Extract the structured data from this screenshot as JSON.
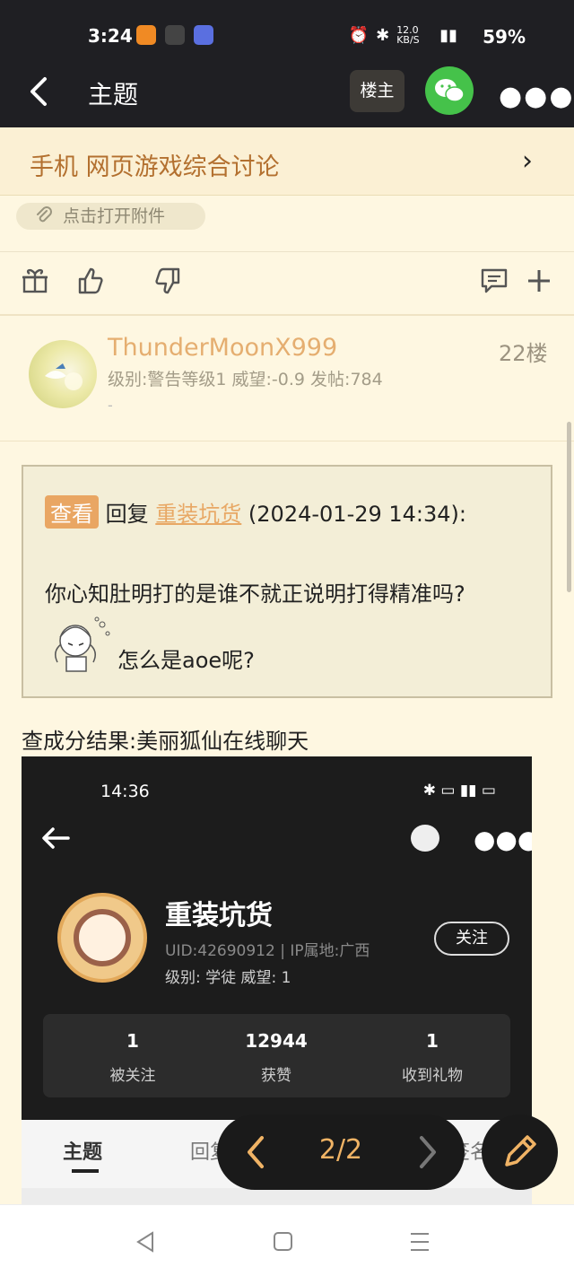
{
  "status_bar": {
    "time": "3:24",
    "network": "12.0 KB/S",
    "battery": "59%"
  },
  "nav": {
    "title": "主题",
    "op_button": "楼主"
  },
  "forum": {
    "name": "手机 网页游戏综合讨论"
  },
  "attachment": {
    "label": "点击打开附件"
  },
  "post": {
    "username": "ThunderMoonX999",
    "info": "级别:警告等级1 威望:-0.9 发帖:784",
    "signature": "-",
    "floor": "22楼"
  },
  "quote": {
    "tag": "查看",
    "reply_word": "回复",
    "reply_user": "重装坑货",
    "reply_time": "(2024-01-29 14:34):",
    "line1": "你心知肚明打的是谁不就正说明打得精准吗?",
    "line2": "怎么是aoe呢?"
  },
  "result_text": "查成分结果:美丽狐仙在线聊天",
  "screenshot": {
    "time": "14:36",
    "username": "重装坑货",
    "uid": "UID:42690912 | IP属地:广西",
    "level": "级别: 学徒  威望: 1",
    "follow": "关注",
    "stats": [
      {
        "num": "1",
        "label": "被关注"
      },
      {
        "num": "12944",
        "label": "获赞"
      },
      {
        "num": "1",
        "label": "收到礼物"
      }
    ],
    "tabs": [
      "主题",
      "回复",
      "签名"
    ]
  },
  "pager": {
    "text": "2/2"
  }
}
